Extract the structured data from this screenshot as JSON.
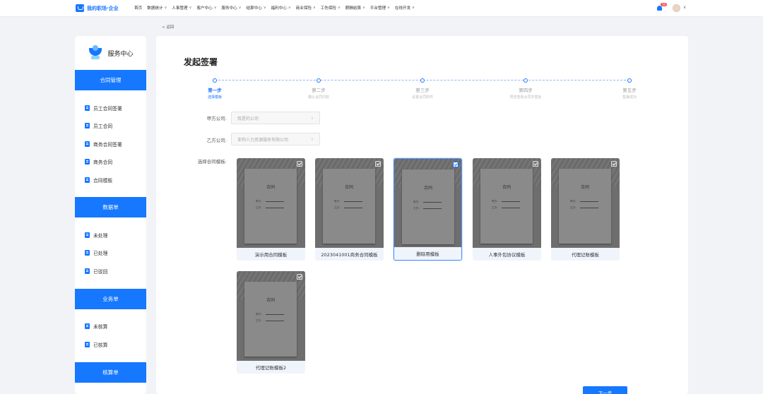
{
  "app": {
    "brand": "我的职场·企业"
  },
  "nav": {
    "items": [
      {
        "label": "首页",
        "has_dropdown": false
      },
      {
        "label": "数据统计",
        "has_dropdown": true
      },
      {
        "label": "人事管理",
        "has_dropdown": true
      },
      {
        "label": "客户中心",
        "has_dropdown": true
      },
      {
        "label": "服务中心",
        "has_dropdown": true
      },
      {
        "label": "结算中心",
        "has_dropdown": true
      },
      {
        "label": "福利中心",
        "has_dropdown": true
      },
      {
        "label": "商业保险",
        "has_dropdown": true
      },
      {
        "label": "工伤保险",
        "has_dropdown": true
      },
      {
        "label": "薪酬结算",
        "has_dropdown": true
      },
      {
        "label": "平台管理",
        "has_dropdown": true
      },
      {
        "label": "在线开发",
        "has_dropdown": true
      }
    ],
    "notification_count": "10"
  },
  "breadcrumb": {
    "back_label": "< 返回"
  },
  "sidebar": {
    "title": "服务中心",
    "groups": [
      {
        "label": "合同管理",
        "items": [
          "员工合同签署",
          "员工合同",
          "商务合同签署",
          "商务合同",
          "合同模板"
        ]
      },
      {
        "label": "数据单",
        "items": [
          "未处理",
          "已处理",
          "已驳回"
        ]
      },
      {
        "label": "业务单",
        "items": [
          "未核算",
          "已核算"
        ]
      },
      {
        "label": "核算单",
        "items": []
      }
    ]
  },
  "main": {
    "title": "发起签署",
    "steps": [
      {
        "title": "第一步",
        "desc": "选择模板",
        "active": true
      },
      {
        "title": "第二步",
        "desc": "确认合同内容",
        "active": false
      },
      {
        "title": "第三步",
        "desc": "设置合同附件",
        "active": false
      },
      {
        "title": "第四步",
        "desc": "预览查看合同并签处",
        "active": false
      },
      {
        "title": "第五步",
        "desc": "签署成功",
        "active": false
      }
    ],
    "form": {
      "party_a_label": "甲方公司:",
      "party_a_value": "我是的公司",
      "party_b_label": "乙方公司:",
      "party_b_value": "亚帅人力资源服务有限公司",
      "template_label": "选择合同模板:"
    },
    "templates": [
      {
        "name": "演示用合同模板",
        "selected": false
      },
      {
        "name": "2023041001商务合同模板",
        "selected": false
      },
      {
        "name": "删除用模板",
        "selected": true
      },
      {
        "name": "人事外包协议模板",
        "selected": false
      },
      {
        "name": "代理记账模板",
        "selected": false
      },
      {
        "name": "代理记账模板2",
        "selected": false
      }
    ],
    "template_preview": {
      "title": "合同",
      "line1": "甲方：",
      "line2": "乙方："
    },
    "next_button": "下一步"
  },
  "colors": {
    "primary": "#1677ff",
    "background": "#f2f3f6"
  }
}
